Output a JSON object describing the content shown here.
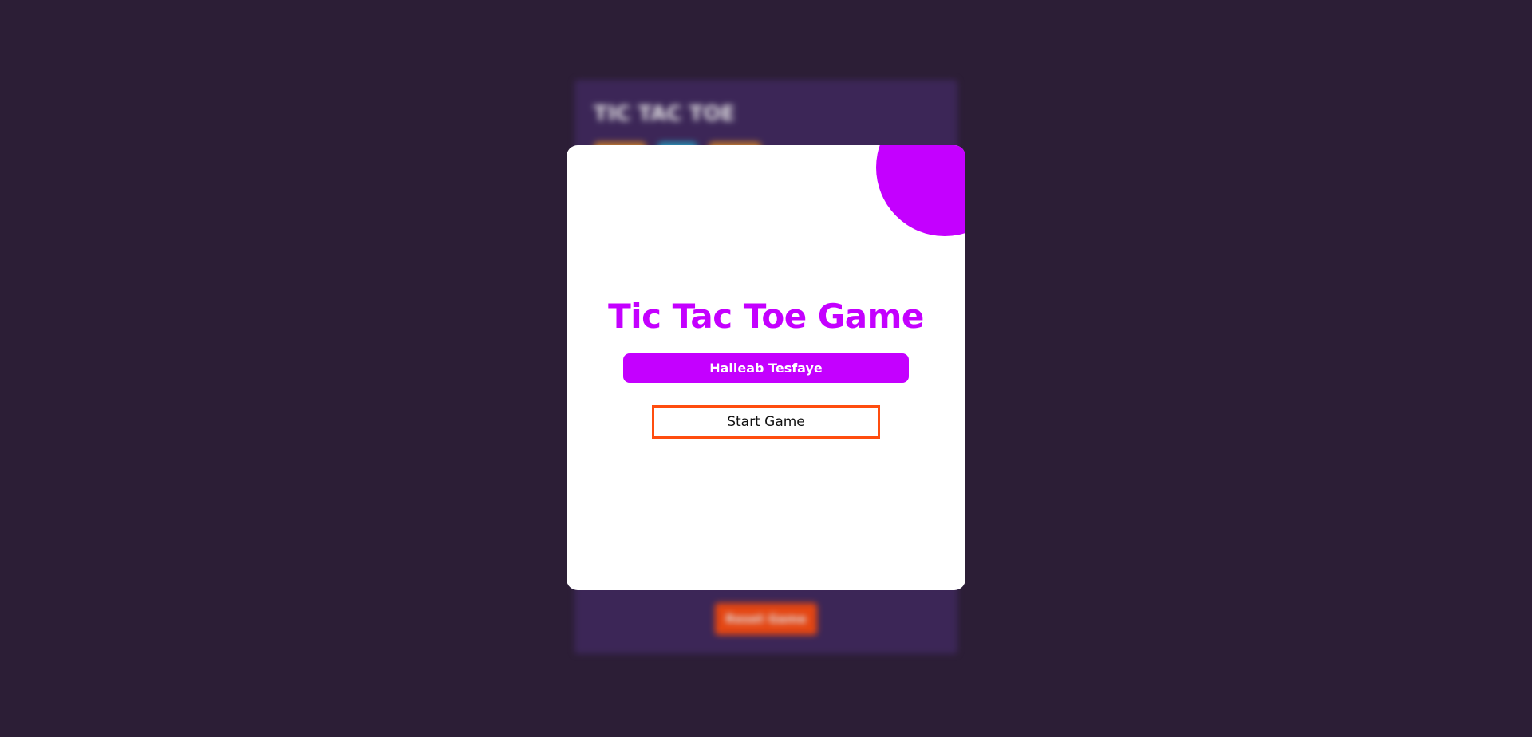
{
  "background_game": {
    "title": "TIC TAC TOE",
    "reset_label": "Reset Game",
    "score_pill_colors": [
      "#d9892e",
      "#2aa3c9",
      "#d9892e"
    ]
  },
  "modal": {
    "title": "Tic Tac Toe Game",
    "author": "Haileab Tesfaye",
    "start_label": "Start Game"
  },
  "colors": {
    "page_bg": "#2e2038",
    "panel_bg": "#402a5e",
    "accent_purple": "#c400ff",
    "accent_orange": "#ff4d0f"
  }
}
